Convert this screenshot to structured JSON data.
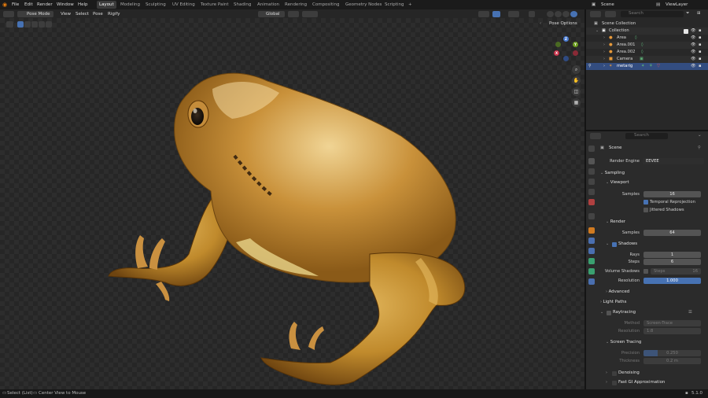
{
  "menu": [
    "File",
    "Edit",
    "Render",
    "Window",
    "Help"
  ],
  "workspaces": [
    "Layout",
    "Modeling",
    "Sculpting",
    "UV Editing",
    "Texture Paint",
    "Shading",
    "Animation",
    "Rendering",
    "Compositing",
    "Geometry Nodes",
    "Scripting"
  ],
  "workspace_active": "Layout",
  "add_tab": "+",
  "scene_name": "Scene",
  "view_layer": "ViewLayer",
  "viewport_header": {
    "mode": "Pose Mode",
    "menus": [
      "View",
      "Select",
      "Pose",
      "Rigify"
    ],
    "transform_orientation": "Global",
    "pose_options": "Pose Options"
  },
  "outliner": {
    "search_placeholder": "Search",
    "root": "Scene Collection",
    "collection": "Collection",
    "items": [
      "Area",
      "Area.001",
      "Area.002",
      "Camera",
      "metarig"
    ],
    "selected": "metarig"
  },
  "properties": {
    "search_placeholder": "Search",
    "breadcrumb": "Scene",
    "render_engine_label": "Render Engine",
    "render_engine": "EEVEE",
    "sampling": "Sampling",
    "viewport": "Viewport",
    "viewport_samples_label": "Samples",
    "viewport_samples": "16",
    "temporal_reprojection": "Temporal Reprojection",
    "jittered_shadows": "Jittered Shadows",
    "render": "Render",
    "render_samples_label": "Samples",
    "render_samples": "64",
    "shadows": "Shadows",
    "rays_label": "Rays",
    "rays": "1",
    "steps_label": "Steps",
    "steps": "6",
    "volume_shadows_label": "Volume Shadows",
    "volume_steps_label": "Steps",
    "volume_steps": "16",
    "resolution_label": "Resolution",
    "resolution": "1.000",
    "advanced": "Advanced",
    "light_paths": "Light Paths",
    "raytracing": "Raytracing",
    "method_label": "Method",
    "method": "Screen-Trace",
    "rt_resolution_label": "Resolution",
    "rt_resolution": "1:8",
    "screen_tracing": "Screen Tracing",
    "precision_label": "Precision",
    "precision": "0.250",
    "thickness_label": "Thickness",
    "thickness": "0.2 m",
    "denoising": "Denoising",
    "fast_gi": "Fast GI Approximation"
  },
  "status": {
    "select": "Select (List)",
    "center": "Center View to Mouse",
    "version": "5.1.0"
  },
  "gizmo": {
    "x": "X",
    "y": "Y",
    "z": "Z"
  },
  "colors": {
    "accent": "#4772b3",
    "selected_row": "#334d80",
    "bg": "#2d2d2d"
  }
}
